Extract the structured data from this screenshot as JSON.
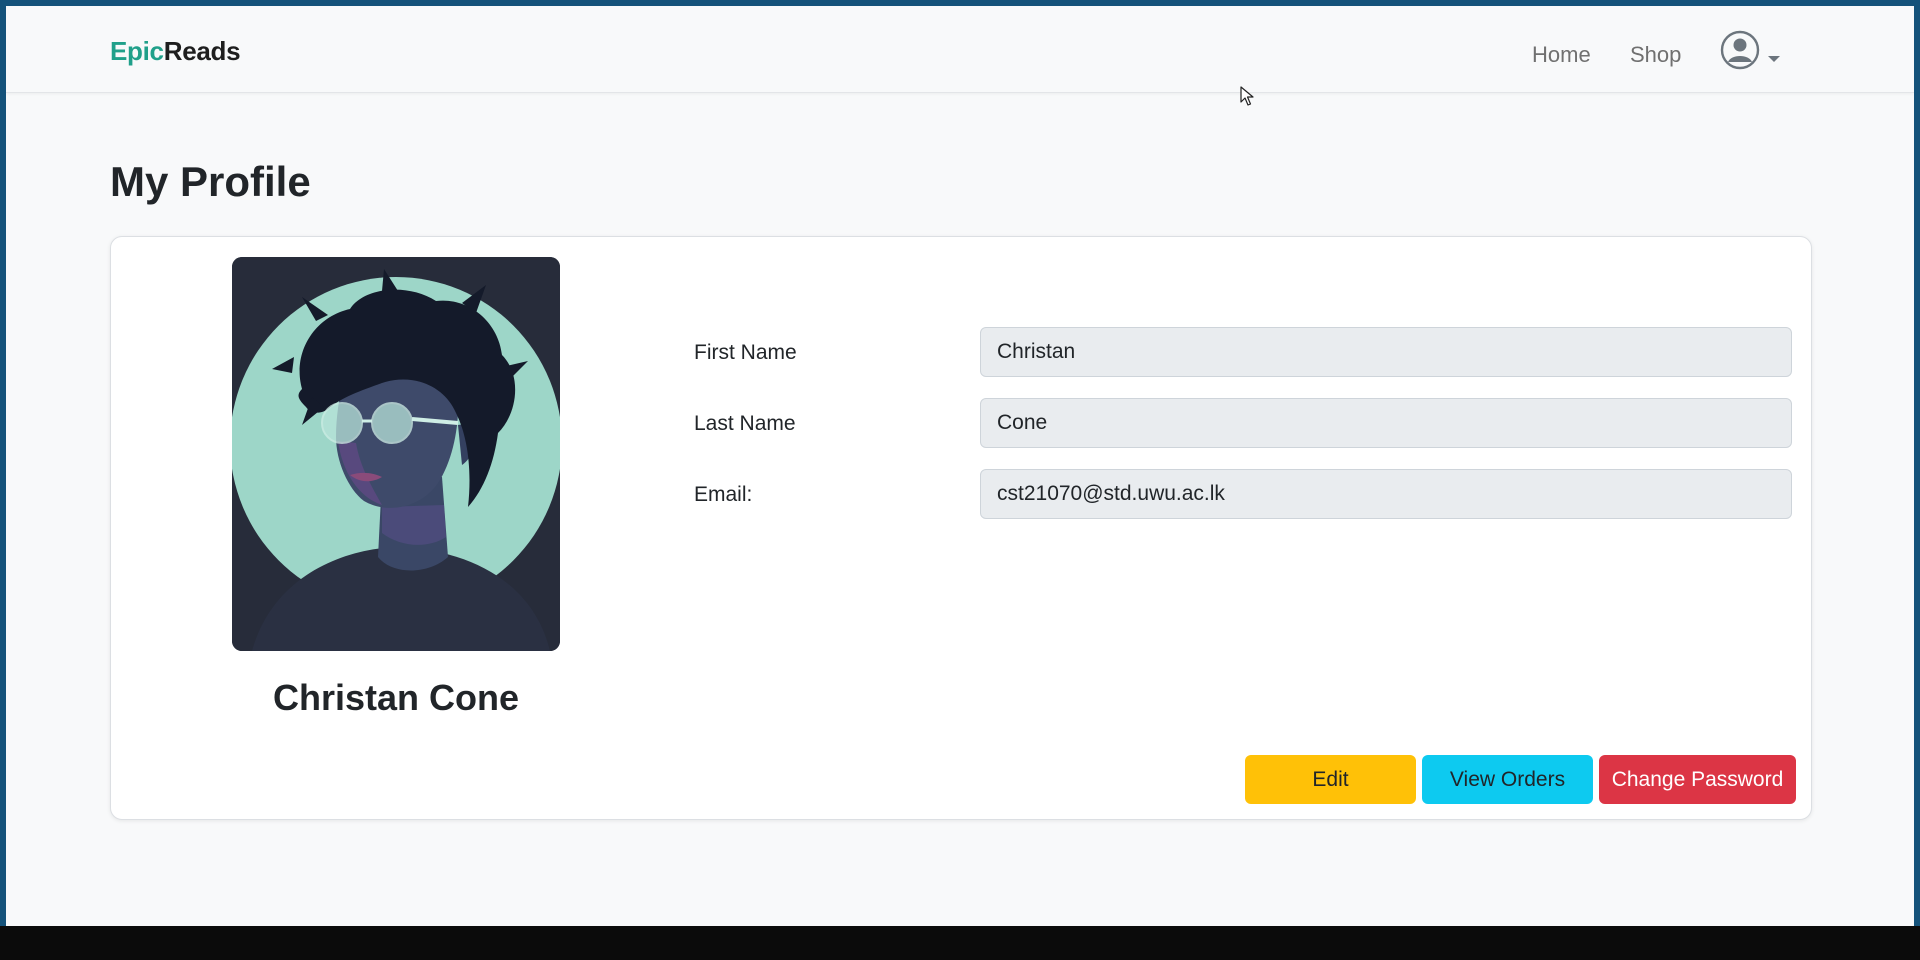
{
  "navbar": {
    "brand_part1": "Epic",
    "brand_part2": "Reads",
    "links": [
      "Home",
      "Shop"
    ],
    "user_menu_icon": "user-circle-icon"
  },
  "page": {
    "title": "My Profile"
  },
  "profile": {
    "full_name": "Christan Cone",
    "avatar_icon": "profile-portrait-illustration",
    "fields": {
      "first_name": {
        "label": "First Name",
        "value": "Christan"
      },
      "last_name": {
        "label": "Last Name",
        "value": "Cone"
      },
      "email": {
        "label": "Email:",
        "value": "cst21070@std.uwu.ac.lk"
      }
    }
  },
  "actions": {
    "edit": "Edit",
    "view_orders": "View Orders",
    "change_password": "Change Password"
  },
  "colors": {
    "brand_accent": "#20a08a",
    "edit_button": "#ffc107",
    "orders_button": "#0dcaf0",
    "password_button": "#dc3545"
  }
}
